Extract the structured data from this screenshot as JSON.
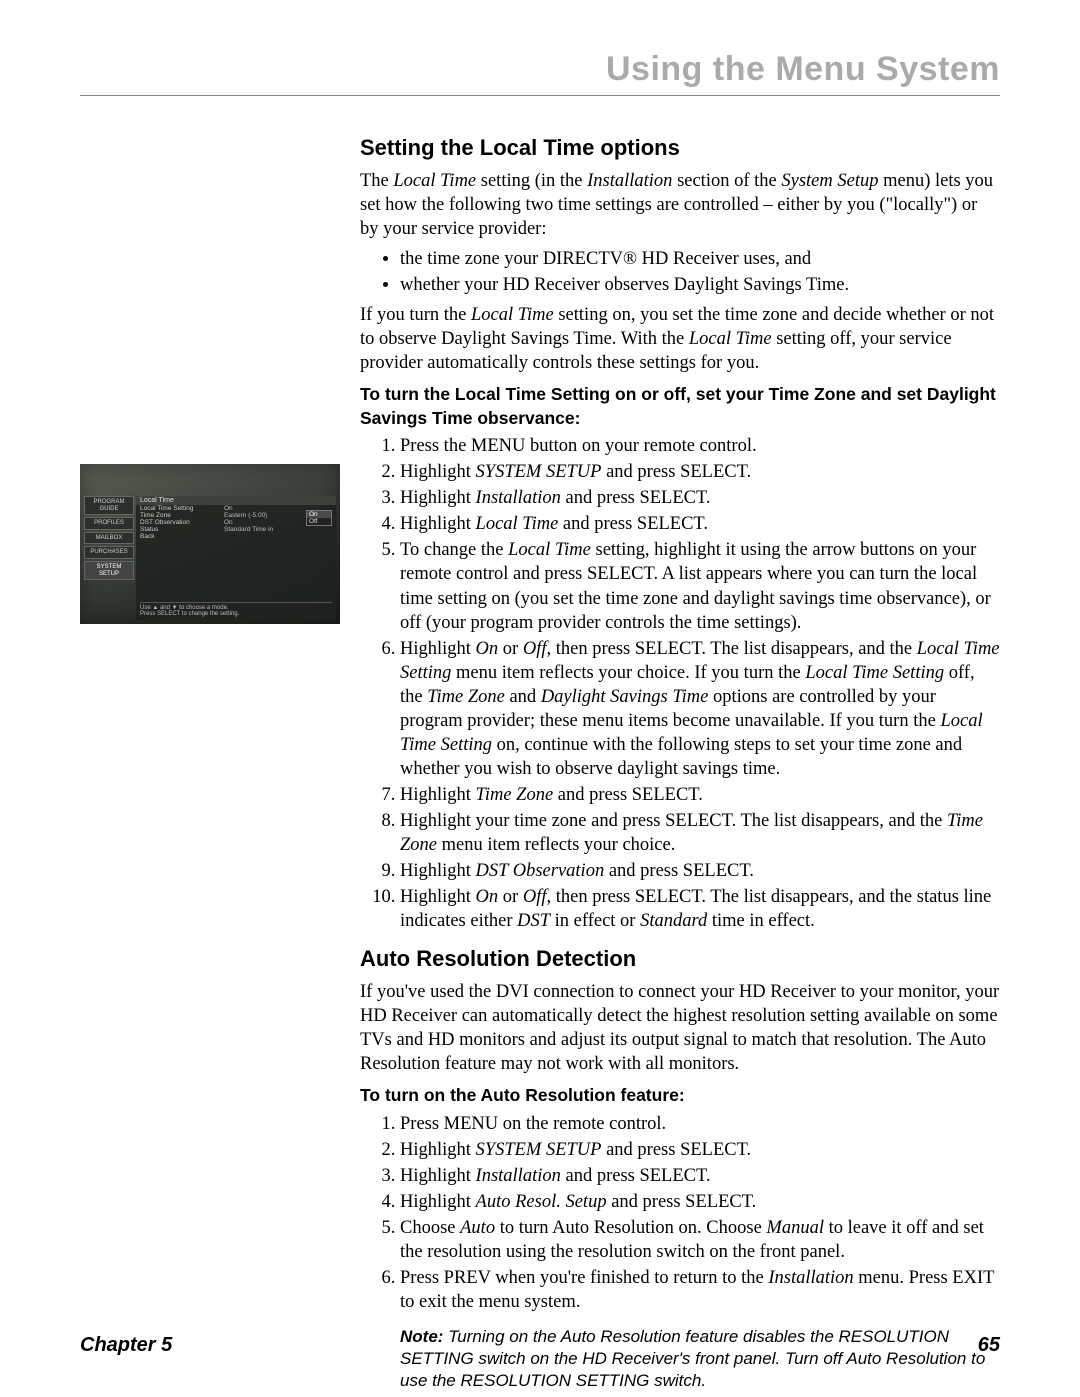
{
  "header": {
    "title": "Using the Menu System"
  },
  "footer": {
    "chapter": "Chapter 5",
    "page": "65"
  },
  "screenshot": {
    "sidebar": [
      "PROGRAM GUIDE",
      "PROFILES",
      "MAILBOX",
      "PURCHASES",
      "SYSTEM SETUP"
    ],
    "panel_title": "Local Time",
    "rows": [
      {
        "label": "Local Time Setting",
        "value": "On"
      },
      {
        "label": "Time Zone",
        "value": "Eastern (-5:00)"
      },
      {
        "label": "DST Observation",
        "value": "On"
      },
      {
        "label": "Status",
        "value": "Standard Time in"
      },
      {
        "label": "Back",
        "value": ""
      }
    ],
    "popup": [
      "On",
      "Off"
    ],
    "hint1": "Use ▲ and ▼ to choose a mode.",
    "hint2": "Press SELECT to change the setting."
  },
  "s1": {
    "heading": "Setting the Local Time options",
    "intro_html": "The <em class='term'>Local Time</em> setting (in the <em class='term'>Installation</em> section of the <em class='term'>System Setup</em> menu) lets you set how the following two time settings are controlled – either by you (\"locally\") or by your service provider:",
    "bullets": [
      "the time zone your DIRECTV® HD Receiver uses, and",
      "whether your HD Receiver observes Daylight Savings Time."
    ],
    "after_bullets_html": "If you turn the <em class='term'>Local Time</em> setting on, you set the time zone and decide whether or not to observe Daylight Savings Time. With the <em class='term'>Local Time</em> setting off, your service provider automatically controls these settings for you.",
    "bold_line": "To turn the Local Time Setting on or off, set your Time Zone and set Daylight Savings Time observance:",
    "steps_html": [
      "Press the MENU button on your remote control.",
      "Highlight <em class='term'>SYSTEM SETUP</em> and press SELECT.",
      "Highlight <em class='term'>Installation</em> and press SELECT.",
      "Highlight <em class='term'>Local Time</em> and press SELECT.",
      "To change the <em class='term'>Local Time</em> setting, highlight it using the arrow buttons on your remote control and press SELECT. A list appears where you can turn the local time setting on (you set the time zone and daylight savings time observance), or off (your program provider controls the time settings).",
      "Highlight <em class='term'>On</em> or <em class='term'>Off</em>, then press SELECT. The list disappears, and the <em class='term'>Local Time Setting</em> menu item reflects your choice. If you turn the <em class='term'>Local Time Setting</em> off, the <em class='term'>Time Zone</em> and <em class='term'>Daylight Savings Time</em> options are controlled by your program provider; these menu items become unavailable. If you turn the <em class='term'>Local Time Setting</em> on, continue with the following steps to set your time zone and whether you wish to observe daylight savings time.",
      "Highlight <em class='term'>Time Zone</em> and press SELECT.",
      "Highlight your time zone and press SELECT. The list disappears, and the <em class='term'>Time Zone</em> menu item reflects your choice.",
      "Highlight <em class='term'>DST Observation</em> and press SELECT.",
      "Highlight <em class='term'>On</em> or <em class='term'>Off</em>, then press SELECT. The list disappears, and the status line indicates either <em class='term'>DST</em> in effect or <em class='term'>Standard</em> time in effect."
    ]
  },
  "s2": {
    "heading": "Auto Resolution Detection",
    "intro": "If you've used the DVI connection to connect your HD Receiver to your monitor, your HD Receiver can automatically detect the highest resolution setting available on some TVs and HD monitors and adjust its output signal to match that resolution. The Auto Resolution feature may not work with all monitors.",
    "bold_line": "To turn on the Auto Resolution feature:",
    "steps_html": [
      "Press MENU on the remote control.",
      "Highlight <em class='term'>SYSTEM SETUP</em> and press SELECT.",
      "Highlight <em class='term'>Installation</em> and press SELECT.",
      "Highlight <em class='term'>Auto Resol. Setup</em> and press SELECT.",
      "Choose <em class='term'>Auto</em> to turn Auto Resolution on. Choose <em class='term'>Manual</em> to leave it off and set the resolution using the resolution switch on the front panel.",
      "Press PREV when you're finished to return to the <em class='term'>Installation</em> menu. Press EXIT to exit the menu system."
    ],
    "note_label": "Note:",
    "note_body": "Turning on the Auto Resolution feature disables the RESOLUTION SETTING switch on the HD Receiver's front panel. Turn off Auto Resolution to use the RESOLUTION SETTING switch."
  }
}
